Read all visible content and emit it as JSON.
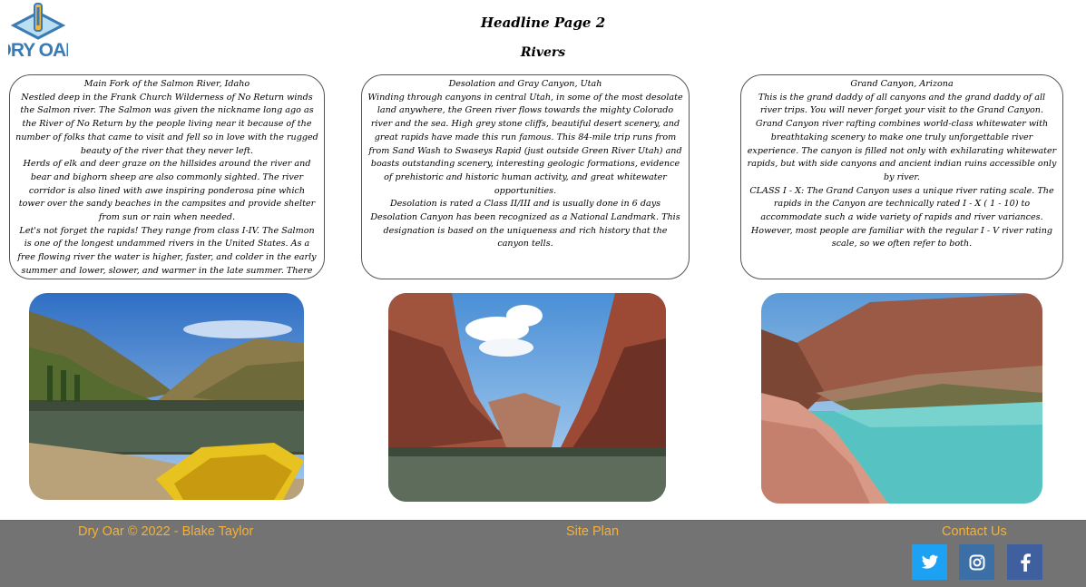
{
  "logo": {
    "text": "DRY OAR"
  },
  "header": {
    "headline": "Headline Page 2",
    "subheadline": "Rivers"
  },
  "cards": [
    {
      "title": "Main Fork of the Salmon River, Idaho",
      "paragraphs": [
        "Nestled deep in the Frank Church Wilderness of No Return winds the Salmon river. The Salmon was given the nickname long ago as the River of No Return by the people living near it because of the number of folks that came to visit and fell so in love with the rugged beauty of the river that they never left.",
        "Herds of elk and deer graze on the hillsides around the river and bear and bighorn sheep are also commonly sighted. The river corridor is also lined with awe inspiring ponderosa pine which tower over the sandy beaches in the campsites and provide shelter from sun or rain when needed.",
        "Let's not forget the rapids! They range from class I-IV. The Salmon is one of the longest undammed rivers in the United States. As a free flowing river the water is higher, faster, and colder in the early summer and lower, slower, and warmer in the late summer. There are good rapids all summer...but families with children who like to swim tend to appreciate the late summer's slower, warmer water more ."
      ]
    },
    {
      "title": "Desolation and Gray Canyon, Utah",
      "paragraphs": [
        "Winding through canyons in central Utah, in some of the most desolate land anywhere, the Green river flows towards the mighty Colorado river and the sea. High grey stone cliffs, beautiful desert scenery, and great rapids have made this run famous. This 84-mile trip runs from from Sand Wash to Swaseys Rapid (just outside Green River Utah) and boasts outstanding scenery, interesting geologic formations, evidence of prehistoric and historic human activity, and great whitewater opportunities.",
        "Desolation is rated a Class II/III and is usually done in 6 days",
        "Desolation Canyon has been recognized as a National Landmark.  This designation is based on the uniqueness and rich history that the canyon tells."
      ]
    },
    {
      "title": "Grand Canyon, Arizona",
      "paragraphs": [
        "This is the grand daddy of all canyons and the grand daddy of all river trips. You will never forget your visit to the Grand Canyon.",
        "Grand Canyon river rafting combines world-class whitewater with breathtaking scenery to make one truly unforgettable river experience. The canyon is filled not only with exhilarating whitewater rapids, but with side canyons and ancient indian ruins accessible only by river.",
        "CLASS I - X: The Grand Canyon uses a unique river rating scale. The rapids in the Canyon are technically rated I - X  ( 1 - 10) to accommodate such a wide variety of rapids and river variances. However, most people are familiar with the regular I - V river rating scale, so we often refer to both."
      ]
    }
  ],
  "footer": {
    "copyright": "Dry Oar © 2022 - Blake Taylor",
    "site_plan": "Site Plan",
    "contact": "Contact Us"
  },
  "social": [
    "twitter-icon",
    "instagram-icon",
    "facebook-icon"
  ],
  "colors": {
    "footer_bg": "#737373",
    "footer_text": "#f4b13b",
    "logo_blue": "#3a7bb5",
    "twitter": "#1da1f2",
    "instagram": "#3b6fa6",
    "facebook": "#3f5f9e"
  }
}
